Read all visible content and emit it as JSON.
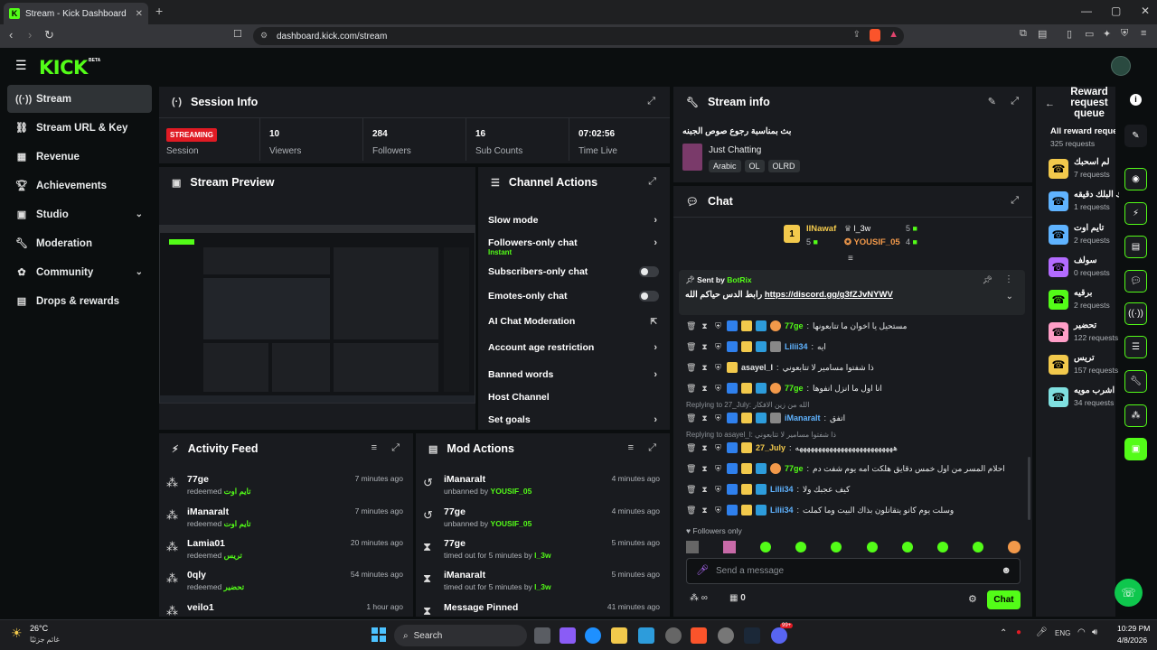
{
  "browser": {
    "tab_title": "Stream - Kick Dashboard",
    "url": "dashboard.kick.com/stream"
  },
  "app": {
    "logo": "KICK",
    "beta": "BETA"
  },
  "sidebar": {
    "items": [
      {
        "label": "Stream",
        "icon": "broadcast-icon",
        "active": true
      },
      {
        "label": "Stream URL & Key",
        "icon": "link-icon"
      },
      {
        "label": "Revenue",
        "icon": "chart-icon"
      },
      {
        "label": "Achievements",
        "icon": "trophy-icon"
      },
      {
        "label": "Studio",
        "icon": "studio-icon",
        "expandable": true
      },
      {
        "label": "Moderation",
        "icon": "wrench-icon"
      },
      {
        "label": "Community",
        "icon": "community-icon",
        "expandable": true
      },
      {
        "label": "Drops & rewards",
        "icon": "gift-icon"
      }
    ]
  },
  "session": {
    "title": "Session Info",
    "status_badge": "STREAMING",
    "status_label": "Session",
    "stats": [
      {
        "value": "10",
        "label": "Viewers"
      },
      {
        "value": "284",
        "label": "Followers"
      },
      {
        "value": "16",
        "label": "Sub Counts"
      },
      {
        "value": "07:02:56",
        "label": "Time Live"
      }
    ]
  },
  "preview": {
    "title": "Stream Preview"
  },
  "channel_actions": {
    "title": "Channel Actions",
    "items": [
      {
        "label": "Slow mode",
        "kind": "chevron"
      },
      {
        "label": "Followers-only chat",
        "sub": "Instant",
        "kind": "chevron"
      },
      {
        "label": "Subscribers-only chat",
        "kind": "toggle"
      },
      {
        "label": "Emotes-only chat",
        "kind": "toggle"
      },
      {
        "label": "AI Chat Moderation",
        "kind": "link"
      },
      {
        "label": "Account age restriction",
        "kind": "chevron"
      },
      {
        "label": "Banned words",
        "kind": "chevron"
      },
      {
        "label": "Host Channel",
        "kind": "none"
      },
      {
        "label": "Set goals",
        "kind": "chevron"
      }
    ]
  },
  "activity": {
    "title": "Activity Feed",
    "items": [
      {
        "name": "77ge",
        "action": "redeemed",
        "reward": "تايم اوت",
        "time": "7 minutes ago"
      },
      {
        "name": "iManaralt",
        "action": "redeemed",
        "reward": "تايم اوت",
        "time": "7 minutes ago"
      },
      {
        "name": "Lamia01",
        "action": "redeemed",
        "reward": "تريس",
        "time": "20 minutes ago"
      },
      {
        "name": "0qly",
        "action": "redeemed",
        "reward": "تحضير",
        "time": "54 minutes ago"
      },
      {
        "name": "veilo1",
        "action": "",
        "reward": "",
        "time": "1 hour ago"
      }
    ]
  },
  "mod_actions": {
    "title": "Mod Actions",
    "items": [
      {
        "name": "iManaralt",
        "action": "unbanned by",
        "by": "YOUSIF_05",
        "time": "4 minutes ago"
      },
      {
        "name": "77ge",
        "action": "unbanned by",
        "by": "YOUSIF_05",
        "time": "4 minutes ago"
      },
      {
        "name": "77ge",
        "action": "timed out for 5 minutes by",
        "by": "l_3w",
        "time": "5 minutes ago"
      },
      {
        "name": "iManaralt",
        "action": "timed out for 5 minutes by",
        "by": "l_3w",
        "time": "5 minutes ago"
      },
      {
        "name": "Message Pinned",
        "action": "",
        "by": "",
        "time": "41 minutes ago"
      }
    ]
  },
  "stream_info": {
    "title": "Stream info",
    "stream_title": "بث بمناسبة رجوع صوص الجبنه",
    "category": "Just Chatting",
    "tags": [
      "Arabic",
      "OL",
      "OLRD"
    ]
  },
  "chat": {
    "title": "Chat",
    "leaderboard": [
      {
        "rank": "1",
        "name": "IINawaf",
        "count": "5"
      },
      {
        "name": "l_3w",
        "count": "5"
      },
      {
        "name": "YOUSIF_05",
        "count": "4"
      }
    ],
    "pinned": {
      "sent_by": "Sent by",
      "sender": "BotRix",
      "text": "رابط الدس حياكم الله",
      "link": "https://discord.gg/g3fZJvNYWV"
    },
    "messages": [
      {
        "user": "77ge",
        "color": "#53fc18",
        "text": "مستحيل يا اخوان ما تتابعونها"
      },
      {
        "user": "Lilii34",
        "color": "#5fb3ff",
        "text": "ايه"
      },
      {
        "user": "asayel_l",
        "color": "#e8eaeb",
        "text": "ذا شفتوا مسامير لا تتابعوني"
      },
      {
        "user": "77ge",
        "color": "#53fc18",
        "text": "انا اول ما انزل انفوها"
      },
      {
        "reply": "Replying to 27_July: الله من زين الافكار"
      },
      {
        "user": "iManaralt",
        "color": "#5fb3ff",
        "text": "اتفق"
      },
      {
        "reply": "Replying to asayel_l: ذا شفتوا مسامير لا تتابعوني"
      },
      {
        "user": "27_July",
        "color": "#f2c94c",
        "text": "ههههههههههههههههههههههههههه"
      },
      {
        "user": "77ge",
        "color": "#53fc18",
        "text": "احلام المسر من اول خمس دقايق هلكت امه يوم شفت دم"
      },
      {
        "user": "Lilii34",
        "color": "#5fb3ff",
        "text": "كيف عجبك ولا"
      },
      {
        "user": "Lilii34",
        "color": "#5fb3ff",
        "text": "وسلت يوم كانو يتقاتلون بذاك البيت وما كملت"
      }
    ],
    "followers_only": "Followers only",
    "input_placeholder": "Send a message",
    "viewer_count": "0",
    "send_label": "Chat"
  },
  "reward_queue": {
    "title": "Reward request queue",
    "all_label": "All reward reque",
    "total": "325 requests",
    "items": [
      {
        "name": "لم اسحبك",
        "count": "7 requests",
        "color": "#f2c94c"
      },
      {
        "name": "ك البلك دقيقه",
        "count": "1 requests",
        "color": "#5fb3ff"
      },
      {
        "name": "تايم اوت",
        "count": "2 requests",
        "color": "#5fb3ff"
      },
      {
        "name": "سولف",
        "count": "0 requests",
        "color": "#b36bff"
      },
      {
        "name": "برقيه",
        "count": "2 requests",
        "color": "#53fc18"
      },
      {
        "name": "تحضير",
        "count": "122 requests",
        "color": "#ff9ec7"
      },
      {
        "name": "تريس",
        "count": "157 requests",
        "color": "#f2c94c"
      },
      {
        "name": "اشرب مويه",
        "count": "34 requests",
        "color": "#7fe0e0"
      }
    ]
  },
  "taskbar": {
    "weather_temp": "26°C",
    "weather_desc": "غائم جزئيًا",
    "search": "Search",
    "lang": "ENG",
    "time": "10:29 PM",
    "date": "4/8/2026",
    "notif_badge": "99+"
  },
  "colors": {
    "accent": "#53fc18",
    "panel": "#191b1f",
    "bg": "#0b0e0f",
    "live": "#e01b24"
  }
}
